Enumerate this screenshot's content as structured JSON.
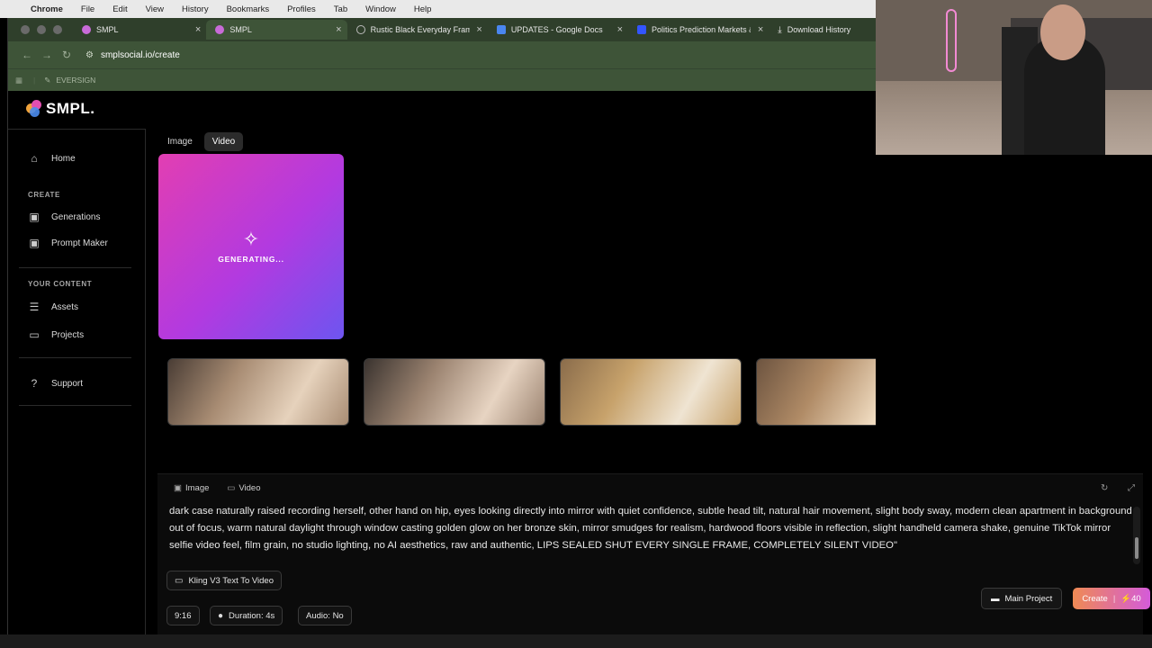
{
  "menubar": {
    "app": "Chrome",
    "items": [
      "File",
      "Edit",
      "View",
      "History",
      "Bookmarks",
      "Profiles",
      "Tab",
      "Window",
      "Help"
    ]
  },
  "tabs": [
    {
      "label": "SMPL",
      "icon_color": "#c86bd8"
    },
    {
      "label": "SMPL",
      "icon_color": "#c86bd8"
    },
    {
      "label": "Rustic Black Everyday Frame",
      "icon_color": "#bbbbbb"
    },
    {
      "label": "UPDATES - Google Docs",
      "icon_color": "#4a86f0"
    },
    {
      "label": "Politics Prediction Markets &",
      "icon_color": "#3355ff"
    },
    {
      "label": "Download History",
      "icon_color": "#dddddd"
    }
  ],
  "address_bar": {
    "url": "smplsocial.io/create"
  },
  "bookmarks": {
    "items": [
      "EVERSIGN"
    ]
  },
  "logo": {
    "text": "SMPL."
  },
  "sidebar": {
    "home": "Home",
    "create_section": "CREATE",
    "generations": "Generations",
    "prompt_maker": "Prompt Maker",
    "content_section": "YOUR CONTENT",
    "assets": "Assets",
    "projects": "Projects",
    "support": "Support"
  },
  "mode_tabs": {
    "image": "Image",
    "video": "Video",
    "active": "Video"
  },
  "generating": {
    "label": "GENERATING..."
  },
  "thumbnails": [
    {
      "name": "mirror-selfie-1",
      "colors": [
        "#a88c73",
        "#e6d2bc",
        "#4a3d35"
      ]
    },
    {
      "name": "mirror-selfie-2",
      "colors": [
        "#9b8370",
        "#e7d4c2",
        "#3a332f"
      ]
    },
    {
      "name": "tank-top-closeup",
      "colors": [
        "#c7a26b",
        "#efe4d2",
        "#8a6c4b"
      ]
    },
    {
      "name": "face-closeup",
      "colors": [
        "#b08b66",
        "#f0dcc1",
        "#6d5440"
      ]
    },
    {
      "name": "drink-closeup",
      "colors": [
        "#c8b8a4",
        "#f2eadf",
        "#a98656"
      ]
    }
  ],
  "prompt_panel": {
    "tab_image": "Image",
    "tab_video": "Video",
    "text": "dark case naturally raised recording herself, other hand on hip, eyes looking directly into mirror with quiet confidence, subtle head tilt, natural hair movement, slight body sway, modern clean apartment in background out of focus, warm natural daylight through window casting golden glow on her bronze skin, mirror smudges for realism, hardwood floors visible in reflection, slight handheld camera shake, genuine TikTok mirror selfie video feel, film grain, no studio lighting, no AI aesthetics, raw and authentic, LIPS SEALED SHUT EVERY SINGLE FRAME, COMPLETELY SILENT VIDEO\"",
    "model": "Kling V3 Text To Video",
    "aspect": "9:16",
    "duration": "Duration: 4s",
    "audio": "Audio: No"
  },
  "actions": {
    "main_project": "Main Project",
    "create": "Create",
    "credits": "40"
  },
  "colors": {
    "accent_gradient_start": "#e23eb2",
    "accent_gradient_end": "#6d55f0",
    "browser_chrome": "#3e5438"
  }
}
